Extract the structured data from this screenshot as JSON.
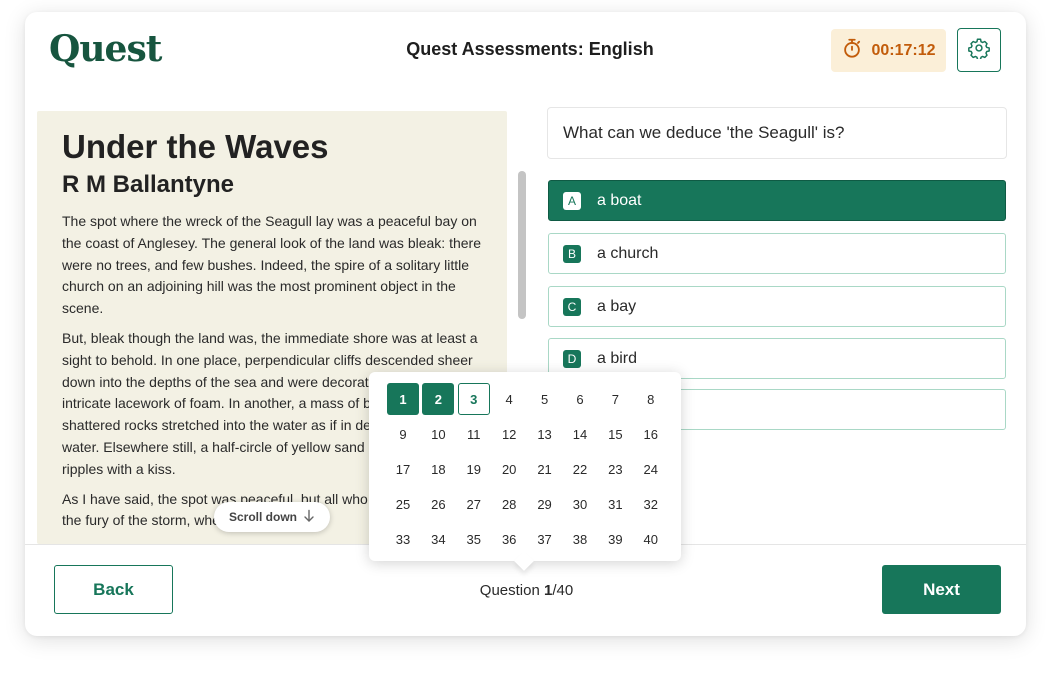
{
  "header": {
    "logo": "Quest",
    "title": "Quest Assessments: English",
    "timer": "00:17:12"
  },
  "passage": {
    "title": "Under the Waves",
    "author": "R M Ballantyne",
    "paragraphs": [
      "The spot where the wreck of the Seagull lay was a peaceful bay on the coast of Anglesey. The general look of the land was bleak: there were no trees, and few bushes. Indeed, the spire of a solitary little church on an adjoining hill was the most prominent object in the scene.",
      "But, bleak though the land was, the immediate shore was at least a sight to behold. In one place, perpendicular cliffs descended sheer down into the depths of the sea and were decorated with an intricate lacework of foam. In another, a mass of boulders and shattered rocks stretched into the water as if in defiance of the water. Elsewhere still, a half-circle of yellow sand received the ripples with a kiss.",
      "As I have said, the spot was peaceful, but all who have not beheld the fury of the storm, when the air was"
    ],
    "scroll_hint": "Scroll down"
  },
  "question": {
    "text": "What can we deduce 'the Seagull' is?",
    "options": [
      {
        "letter": "A",
        "text": "a boat"
      },
      {
        "letter": "B",
        "text": "a church"
      },
      {
        "letter": "C",
        "text": "a bay"
      },
      {
        "letter": "D",
        "text": "a bird"
      },
      {
        "letter": "E",
        "text": ""
      }
    ],
    "selected": "A"
  },
  "navigator": {
    "numbers": [
      "1",
      "2",
      "3",
      "4",
      "5",
      "6",
      "7",
      "8",
      "9",
      "10",
      "11",
      "12",
      "13",
      "14",
      "15",
      "16",
      "17",
      "18",
      "19",
      "20",
      "21",
      "22",
      "23",
      "24",
      "25",
      "26",
      "27",
      "28",
      "29",
      "30",
      "31",
      "32",
      "33",
      "34",
      "35",
      "36",
      "37",
      "38",
      "39",
      "40"
    ],
    "answered": [
      1,
      2
    ],
    "current": 3
  },
  "footer": {
    "back_label": "Back",
    "next_label": "Next",
    "question_prefix": "Question ",
    "question_current": "1",
    "question_total": "/40"
  },
  "colors": {
    "brand": "#17765a",
    "logo": "#17553f",
    "timer_bg": "#fbefd8",
    "timer_text": "#c25c0b",
    "passage_bg": "#f3f1e4"
  },
  "icons": {
    "timer": "stopwatch-icon",
    "settings": "gear-icon",
    "scroll": "arrow-down-icon"
  }
}
